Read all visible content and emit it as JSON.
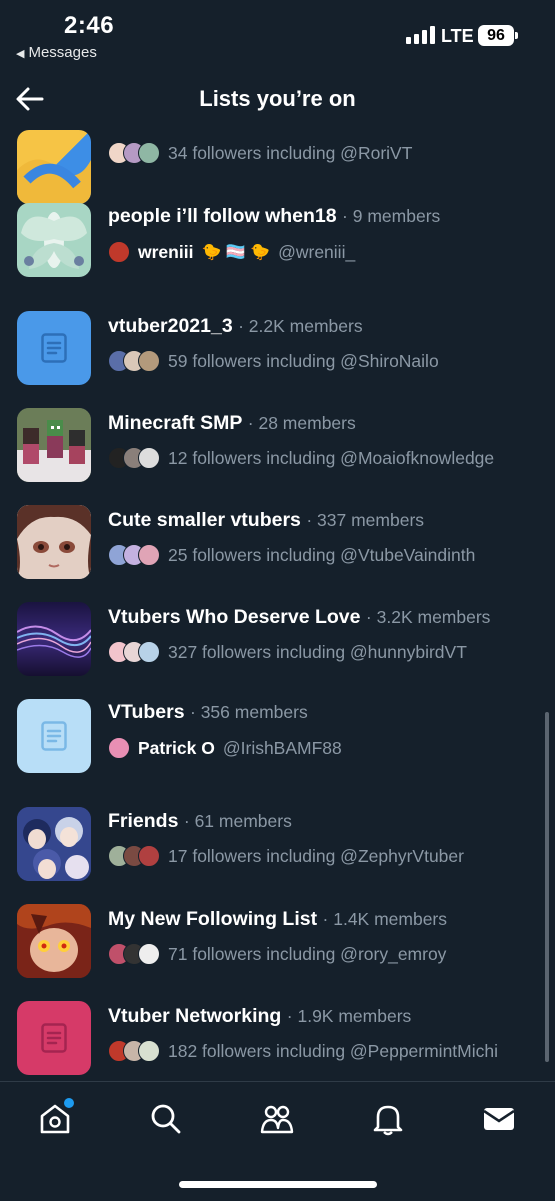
{
  "status": {
    "time": "2:46",
    "back_app": "Messages",
    "network": "LTE",
    "battery": "96"
  },
  "header": {
    "title": "Lists you’re on"
  },
  "lists": [
    {
      "name": "",
      "meta": "",
      "subtitle": "34 followers including @RoriVT",
      "thumb": "icon-yellow-blue",
      "avatar_colors": [
        "#f0d6c8",
        "#b59ac4",
        "#8fb7a4"
      ]
    },
    {
      "name": "people i’ll follow when18",
      "meta": "9 members",
      "owner": "wreniii",
      "emojis": "🐤 🏳️‍⚧️ 🐤",
      "subtitle": "@wreniii_",
      "thumb": "art-green-moth",
      "avatar_colors": [
        "#c0392b"
      ]
    },
    {
      "name": "vtuber2021_3",
      "meta": "2.2K members",
      "subtitle": "59 followers including @ShiroNailo",
      "thumb": "list-icon-blue",
      "avatar_colors": [
        "#5a6ea8",
        "#d9c7b8",
        "#b39a7c"
      ]
    },
    {
      "name": "Minecraft SMP",
      "meta": "28 members",
      "subtitle": "12 followers including @Moaiofknowledge",
      "thumb": "art-minecraft",
      "avatar_colors": [
        "#222222",
        "#8a7f7a",
        "#dddddd"
      ]
    },
    {
      "name": "Cute smaller vtubers",
      "meta": "337 members",
      "subtitle": "25 followers including @VtubeVaindinth",
      "thumb": "art-anime-girl",
      "avatar_colors": [
        "#8fa4d6",
        "#c4b1e0",
        "#e0a4b6"
      ]
    },
    {
      "name": "Vtubers Who Deserve Love",
      "meta": "3.2K members",
      "subtitle": "327 followers including @hunnybirdVT",
      "thumb": "art-purple-waves",
      "avatar_colors": [
        "#f2c4cc",
        "#e8d6d6",
        "#b8d2e8"
      ]
    },
    {
      "name": "VTubers",
      "meta": "356 members",
      "owner": "Patrick O",
      "subtitle": "@IrishBAMF88",
      "thumb": "list-icon-lightblue",
      "avatar_colors": [
        "#e88fb4"
      ]
    },
    {
      "name": "Friends",
      "meta": "61 members",
      "subtitle": "17 followers including @ZephyrVtuber",
      "thumb": "art-anime-group",
      "avatar_colors": [
        "#9fb09a",
        "#7a4a42",
        "#b04040"
      ]
    },
    {
      "name": "My New Following List",
      "meta": "1.4K members",
      "subtitle": "71 followers including @rory_emroy",
      "thumb": "art-red-eyes",
      "avatar_colors": [
        "#c0506a",
        "#333333",
        "#eeeeee"
      ]
    },
    {
      "name": "Vtuber Networking",
      "meta": "1.9K members",
      "subtitle": "182 followers including @PeppermintMichi",
      "thumb": "list-icon-pink",
      "avatar_colors": [
        "#c0392b",
        "#c8b5a8",
        "#d8e0d0"
      ]
    }
  ],
  "tabs": [
    "home-icon",
    "search-icon",
    "communities-icon",
    "notifications-icon",
    "messages-icon"
  ]
}
